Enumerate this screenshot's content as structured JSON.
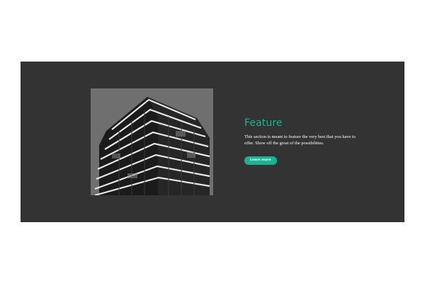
{
  "feature": {
    "image": {
      "subject": "black-and-white photo of a modern high-rise building with cantilevered balconies"
    },
    "title": "Feature",
    "description": "This section is meant to feature the very best that you have to offer. Show off the great of the possibilities.",
    "button_label": "Learn more"
  },
  "colors": {
    "panel_background": "#333333",
    "page_background": "#ffffff",
    "accent": "#1ab394",
    "text": "#ffffff"
  }
}
